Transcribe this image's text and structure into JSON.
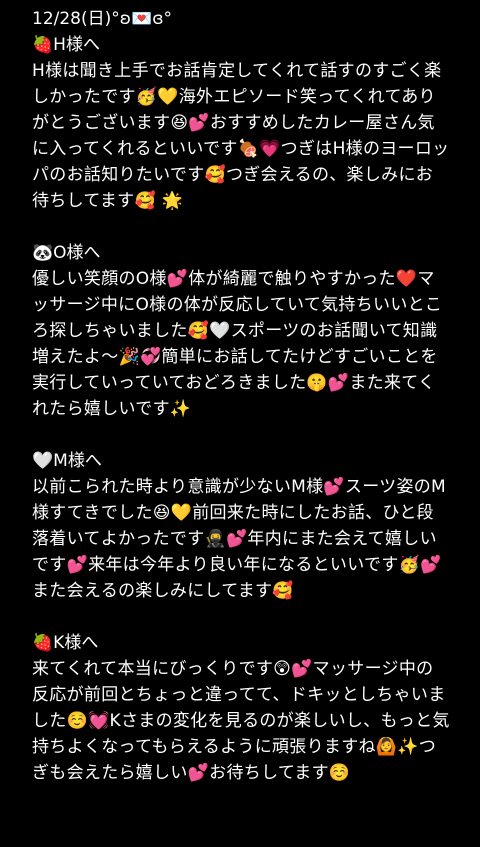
{
  "header": {
    "date_line": "12/28(日)°ʚ💌ɞ°"
  },
  "messages": [
    {
      "title": "🍓H様へ",
      "body": "H様は聞き上手でお話肯定してくれて話すのすごく楽しかったです🥳💛海外エピソード笑ってくれてありがとうございます😆💕おすすめしたカレー屋さん気に入ってくれるといいです🍖💗つぎはH様のヨーロッパのお話知りたいです🥰つぎ会えるの、楽しみにお待ちしてます🥰 🌟"
    },
    {
      "title": "🐼O様へ",
      "body": "優しい笑顔のO様💕体が綺麗で触りやすかった❤️マッサージ中にO様の体が反応していて気持ちいいところ探しちゃいました🥰🤍スポーツのお話聞いて知識増えたよ〜🎉💞簡単にお話してたけどすごいことを実行していっていておどろきました🤫💕また来てくれたら嬉しいです✨"
    },
    {
      "title": "🤍M様へ",
      "body": "以前こられた時より意識が少ないM様💕スーツ姿のM様すてきでした😆💛前回来た時にしたお話、ひと段落着いてよかったです🥷💕年内にまた会えて嬉しいです💕来年は今年より良い年になるといいです🥳💕また会えるの楽しみにしてます🥰"
    },
    {
      "title": "🍓K様へ",
      "body": "来てくれて本当にびっくりです😲💕マッサージ中の反応が前回とちょっと違ってて、ドキッとしちゃいました☺️💓Kさまの変化を見るのが楽しいし、もっと気持ちよくなってもらえるように頑張りますね🙆✨つぎも会えたら嬉しい💕お待ちしてます☺️"
    }
  ]
}
